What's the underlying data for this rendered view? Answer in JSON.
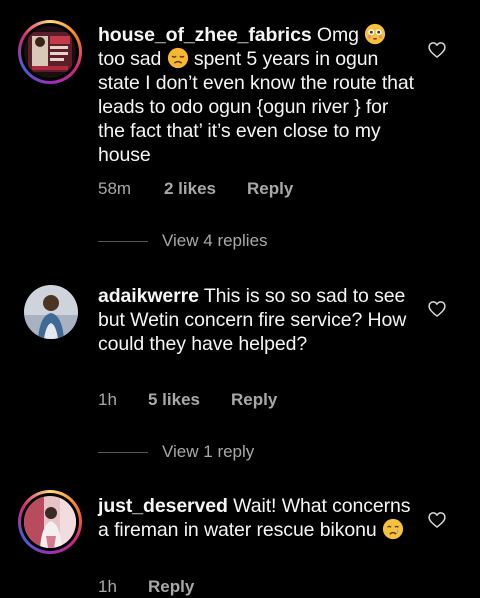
{
  "comments": [
    {
      "username": "house_of_zhee_fabrics",
      "text_1": " Omg ",
      "emoji_1": "flushed-face",
      "text_2": " too sad ",
      "emoji_2": "disappointed-face",
      "text_3": " spent 5 years in ogun state I don’t even know the route that leads to odo ogun {ogun river } for the fact that’ it’s even close to my house",
      "time": "58m",
      "likes": "2 likes",
      "reply": "Reply",
      "view_replies": "View 4 replies"
    },
    {
      "username": "adaikwerre",
      "text_1": " This is so so sad to see but Wetin concern fire service? How could they have helped?",
      "time": "1h",
      "likes": "5 likes",
      "reply": "Reply",
      "view_replies": "View 1 reply"
    },
    {
      "username": "just_deserved",
      "text_1": " Wait! What concerns a fireman in water rescue bikonu ",
      "emoji_1": "crying-face",
      "time": "1h",
      "reply": "Reply"
    }
  ],
  "colors": {
    "background": "#000000",
    "text": "#f5f5f5",
    "secondary": "#a8a8a8",
    "divider": "#555555"
  }
}
